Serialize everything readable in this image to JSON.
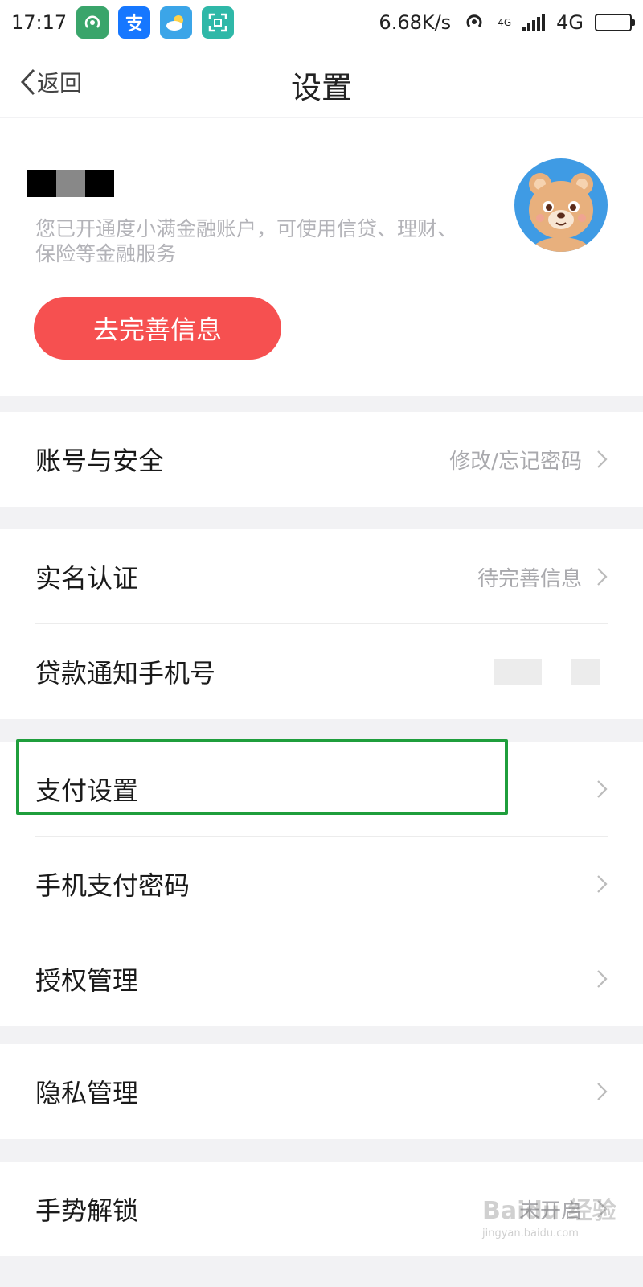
{
  "status_bar": {
    "time": "17:17",
    "network_speed": "6.68K/s",
    "network_type": "4G",
    "small_network_label": "4G",
    "app_icons": [
      "hotspot-app-icon",
      "alipay-app-icon",
      "weather-app-icon",
      "scanner-app-icon"
    ]
  },
  "nav": {
    "back_label": "返回",
    "title": "设置"
  },
  "profile": {
    "description": "您已开通度小满金融账户，可使用信贷、理财、保险等金融服务",
    "complete_button": "去完善信息"
  },
  "groups": [
    {
      "rows": [
        {
          "label": "账号与安全",
          "value": "修改/忘记密码",
          "chevron": true
        }
      ]
    },
    {
      "rows": [
        {
          "label": "实名认证",
          "value": "待完善信息",
          "chevron": true
        },
        {
          "label": "贷款通知手机号",
          "value": "",
          "masked": true,
          "chevron": false
        }
      ]
    },
    {
      "rows": [
        {
          "label": "支付设置",
          "value": "",
          "chevron": true,
          "highlighted": true
        },
        {
          "label": "手机支付密码",
          "value": "",
          "chevron": true
        },
        {
          "label": "授权管理",
          "value": "",
          "chevron": true
        }
      ]
    },
    {
      "rows": [
        {
          "label": "隐私管理",
          "value": "",
          "chevron": true
        }
      ]
    },
    {
      "rows": [
        {
          "label": "手势解锁",
          "value": "未开启",
          "chevron": true
        }
      ]
    }
  ],
  "watermark": {
    "brand": "Baidu 经验",
    "url": "jingyan.baidu.com"
  },
  "colors": {
    "accent_red": "#f65050",
    "highlight_green": "#1f9e3c",
    "avatar_blue": "#3f9be4"
  }
}
